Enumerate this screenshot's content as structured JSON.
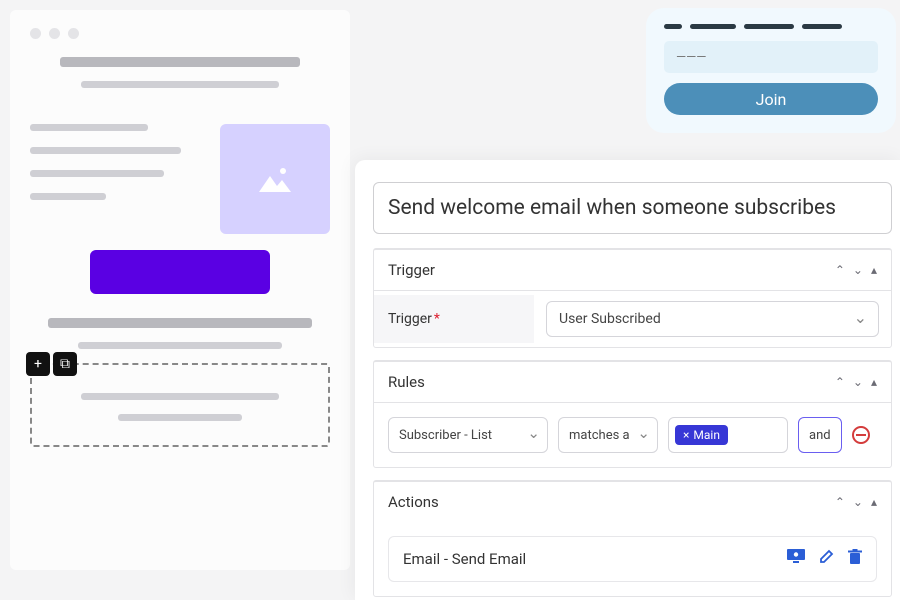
{
  "wireframe": {
    "handle_plus": "+",
    "handle_dup": "⧉",
    "image_placeholder": "image-placeholder"
  },
  "join_card": {
    "input_placeholder": "———",
    "button_label": "Join"
  },
  "automation": {
    "title": "Send welcome email when someone subscribes",
    "trigger": {
      "header": "Trigger",
      "field_label": "Trigger",
      "value": "User Subscribed"
    },
    "rules": {
      "header": "Rules",
      "field_select": "Subscriber - List",
      "operator": "matches a",
      "value_pill": "Main",
      "conjunction": "and"
    },
    "actions": {
      "header": "Actions",
      "item_label": "Email - Send Email"
    },
    "controls": {
      "up": "⌃",
      "down": "⌄",
      "collapse": "▴"
    }
  }
}
